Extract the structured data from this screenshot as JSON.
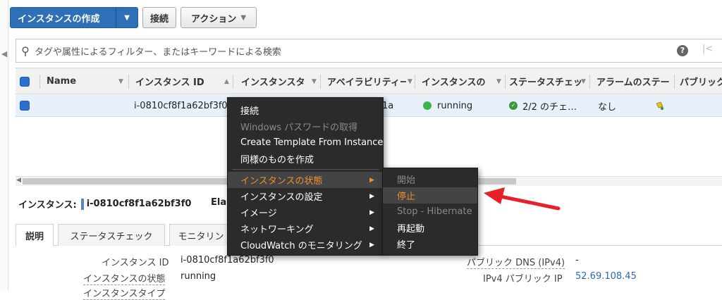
{
  "toolbar": {
    "create_label": "インスタンスの作成",
    "connect_label": "接続",
    "actions_label": "アクション"
  },
  "search": {
    "placeholder": "タグや属性によるフィルター、またはキーワードによる検索"
  },
  "table": {
    "headers": {
      "name": "Name",
      "instance_id": "インスタンス ID",
      "instance_type": "インスタンスタ",
      "az": "アベイラビリティー",
      "state": "インスタンスの",
      "status_check": "ステータスチェッ",
      "alarm": "アラームのステー",
      "public": "パブリック"
    },
    "row": {
      "name": "",
      "instance_id": "i-0810cf8f1a62bf3f0",
      "az_suffix": "1a",
      "state": "running",
      "status_check": "2/2 のチェ…",
      "alarm": "なし"
    }
  },
  "context_menu": {
    "items": [
      {
        "label": "接続"
      },
      {
        "label": "Windows パスワードの取得"
      },
      {
        "label": "Create Template From Instance"
      },
      {
        "label": "同様のものを作成"
      },
      {
        "label": "インスタンスの状態"
      },
      {
        "label": "インスタンスの設定"
      },
      {
        "label": "イメージ"
      },
      {
        "label": "ネットワーキング"
      },
      {
        "label": "CloudWatch のモニタリング"
      }
    ]
  },
  "submenu": {
    "items": [
      {
        "label": "開始"
      },
      {
        "label": "停止"
      },
      {
        "label": "Stop - Hibernate"
      },
      {
        "label": "再起動"
      },
      {
        "label": "終了"
      }
    ]
  },
  "details": {
    "title_label": "インスタンス:",
    "instance_id": "i-0810cf8f1a62bf3f0",
    "elastic": "Elasti",
    "tabs": [
      "説明",
      "ステータスチェック",
      "モニタリン"
    ],
    "fields": {
      "instance_id_label": "インスタンス ID",
      "instance_id_value": "i-0810cf8f1a62bf3f0",
      "state_label": "インスタンスの状態",
      "state_value": "running",
      "type_label": "インスタンスタイプ",
      "public_dns_label": "パブリック DNS (IPv4)",
      "public_dns_value": "-",
      "public_ip_label": "IPv4 パブリック IP",
      "public_ip_value": "52.69.108.45"
    }
  },
  "colors": {
    "primary_button": "#2f6fb7",
    "menu_bg": "#2b2b2b",
    "menu_highlight": "#ec912d",
    "running": "#3bb54a",
    "arrow": "#e8202a"
  }
}
